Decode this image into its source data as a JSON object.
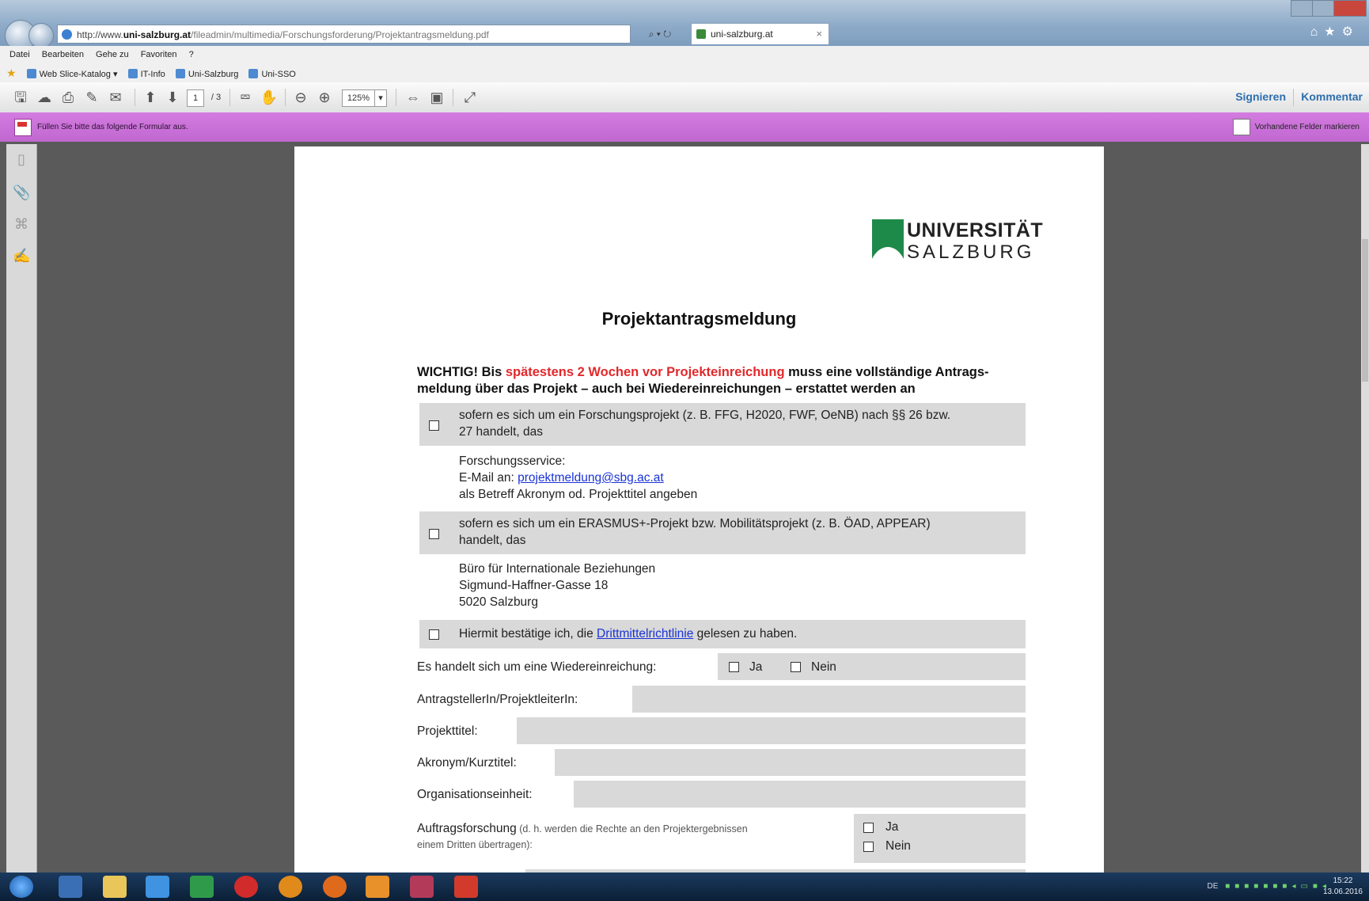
{
  "browser": {
    "url_domain": "uni-salzburg.at",
    "url_prefix": "http://www.",
    "url_path": "/fileadmin/multimedia/Forschungsforderung/Projektantragsmeldung.pdf",
    "search_label": "⌕ ▾ ↻",
    "tab_title": "uni-salzburg.at",
    "tab_close": "×"
  },
  "menubar": {
    "items": [
      "Datei",
      "Bearbeiten",
      "Gehe zu",
      "Favoriten",
      "?"
    ]
  },
  "favorites": {
    "items": [
      "Web Slice-Katalog ▾",
      "IT-Info",
      "Uni-Salzburg",
      "Uni-SSO"
    ]
  },
  "reader": {
    "page_current": "1",
    "page_total": "/ 3",
    "zoom": "125%",
    "sign_label": "Signieren",
    "comment_label": "Kommentar"
  },
  "formbar": {
    "message": "Füllen Sie bitte das folgende Formular aus.",
    "highlight_label": "Vorhandene Felder markieren"
  },
  "document": {
    "logo_line1": "UNIVERSITÄT",
    "logo_line2": "SALZBURG",
    "title": "Projektantragsmeldung",
    "intro_part1": "WICHTIG! Bis ",
    "intro_red": "spätestens 2 Wochen vor Projekteinreichung",
    "intro_part2": "  muss eine vollständige Antrags-",
    "intro_line2": "meldung über das Projekt – auch bei Wiedereinreichungen – erstattet werden an",
    "option1_line1": "sofern es sich um ein Forschungsprojekt (z. B. FFG, H2020, FWF, OeNB) nach §§ 26 bzw.",
    "option1_line2": "27 handelt, das",
    "contact1_line1": "Forschungsservice:",
    "contact1_email_prefix": "E-Mail an: ",
    "contact1_email": "projektmeldung@sbg.ac.at",
    "contact1_line3": "als Betreff Akronym od. Projekttitel angeben",
    "option2_line1": "sofern es sich um ein ERASMUS+-Projekt bzw. Mobilitätsprojekt (z. B. ÖAD, APPEAR)",
    "option2_line2": "handelt, das",
    "contact2_line1": "Büro für Internationale Beziehungen",
    "contact2_line2": "Sigmund-Haffner-Gasse 18",
    "contact2_line3": "5020 Salzburg",
    "confirm_prefix": "Hiermit bestätige ich, die ",
    "confirm_link": "Drittmittelrichtlinie",
    "confirm_suffix": " gelesen zu haben.",
    "resubmission_label": "Es handelt sich um eine Wiedereinreichung:",
    "yes_label": "Ja",
    "no_label": "Nein",
    "applicant_label": "AntragstellerIn/ProjektleiterIn:",
    "project_title_label": "Projekttitel:",
    "acronym_label": "Akronym/Kurztitel:",
    "org_unit_label": "Organisationseinheit:",
    "contract_label": "Auftragsforschung",
    "contract_note1": " (d. h. werden die Rechte an den Projektergebnissen",
    "contract_note2": "einem Dritten übertragen):"
  },
  "taskbar": {
    "tray_lang": "DE",
    "clock_time": "15:22",
    "clock_date": "13.06.2016"
  },
  "colors": {
    "accent_red": "#e2282b",
    "link_blue": "#1a33d4",
    "form_bar": "#c96fd8",
    "field_gray": "#d9d9d9",
    "logo_green": "#1e8a4a"
  }
}
